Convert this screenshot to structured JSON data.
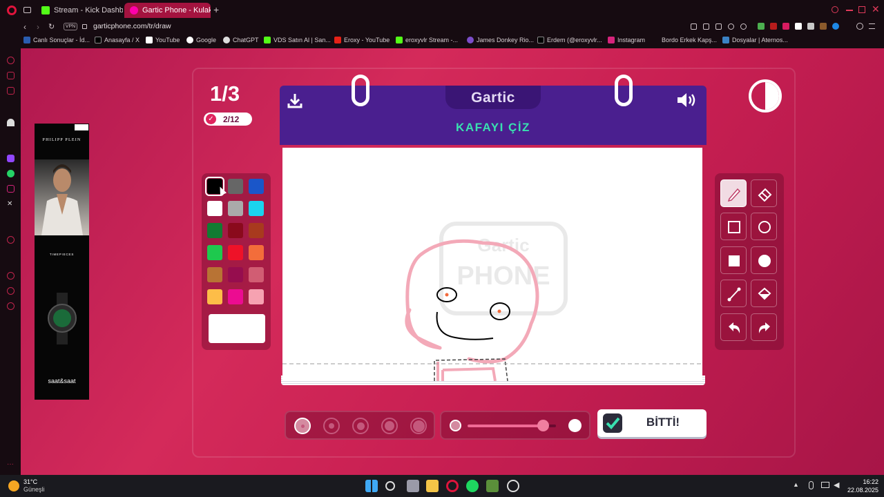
{
  "browser": {
    "tabs": [
      {
        "title": "Stream - Kick Dashboard",
        "active": false
      },
      {
        "title": "Gartic Phone - Kulaktan K",
        "active": true
      }
    ],
    "vpn_label": "VPN",
    "url": "garticphone.com/tr/draw",
    "bookmarks": [
      "Canlı Sonuçlar - İd...",
      "Anasayfa / X",
      "YouTube",
      "Google",
      "ChatGPT",
      "VDS Satın Al | San...",
      "Eroxy - YouTube",
      "eroxyvlr Stream -...",
      "James Donkey Rio...",
      "Erdem (@eroxyvlr...",
      "Instagram",
      "Bordo Erkek Kapş...",
      "Dosyalar | Aternos..."
    ]
  },
  "ad": {
    "brand": "PHILIPP PLEIN",
    "tagline": "TIMEPIECES",
    "shop": "saat&saat"
  },
  "game": {
    "round": "1/3",
    "players_done": "2/12",
    "logo": "Gartic",
    "task": "KAFAYI ÇİZ",
    "watermark_top": "Gartic",
    "watermark_bottom": "PHONE",
    "done_label": "BİTTİ!",
    "selected_color": "#000000",
    "selected_tool": "pencil-icon",
    "colors": [
      "#000000",
      "#666666",
      "#1a56c9",
      "#ffffff",
      "#aaaaaa",
      "#1ad4ee",
      "#127b32",
      "#8a0a1c",
      "#a83a1e",
      "#1ec94e",
      "#ee1228",
      "#f36d3a",
      "#b87334",
      "#960d4e",
      "#d15d73",
      "#fdbd48",
      "#ec0c91",
      "#f6a2b1"
    ],
    "brush_sizes": [
      1,
      2,
      3,
      4,
      5
    ],
    "selected_brush_size": 1,
    "opacity_level": 0.85
  },
  "taskbar": {
    "temperature": "31°C",
    "weather": "Güneşli",
    "time": "16:22",
    "date": "22.08.2025"
  }
}
